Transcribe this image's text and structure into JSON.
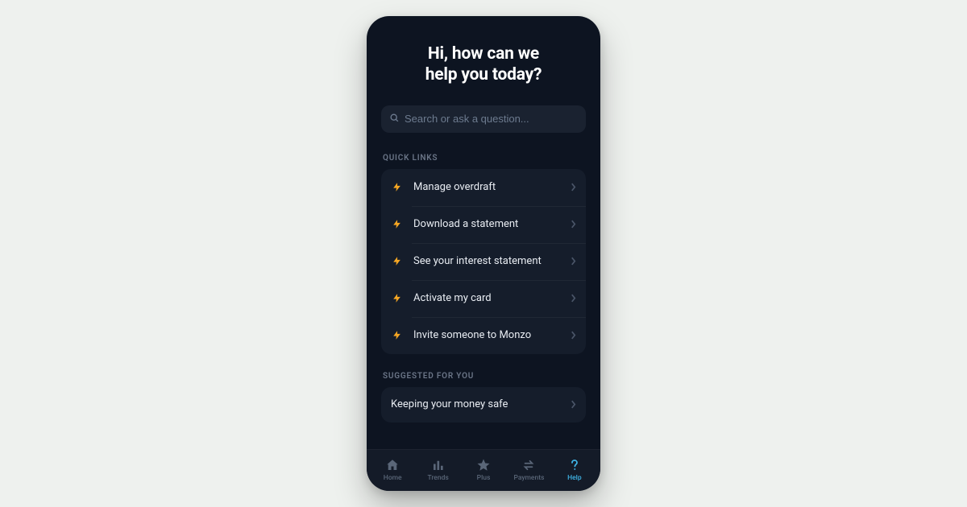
{
  "title_line1": "Hi, how can we",
  "title_line2": "help you today?",
  "search": {
    "placeholder": "Search or ask a question..."
  },
  "quick_links": {
    "heading": "QUICK LINKS",
    "items": [
      {
        "label": "Manage overdraft"
      },
      {
        "label": "Download a statement"
      },
      {
        "label": "See your interest statement"
      },
      {
        "label": "Activate my card"
      },
      {
        "label": "Invite someone to Monzo"
      }
    ]
  },
  "suggested": {
    "heading": "SUGGESTED FOR YOU",
    "items": [
      {
        "label": "Keeping your money safe"
      }
    ]
  },
  "tabs": {
    "items": [
      {
        "label": "Home"
      },
      {
        "label": "Trends"
      },
      {
        "label": "Plus"
      },
      {
        "label": "Payments"
      },
      {
        "label": "Help"
      }
    ],
    "active_index": 4
  },
  "colors": {
    "accent": "#3fb4e6",
    "bolt": "#f5a623"
  }
}
